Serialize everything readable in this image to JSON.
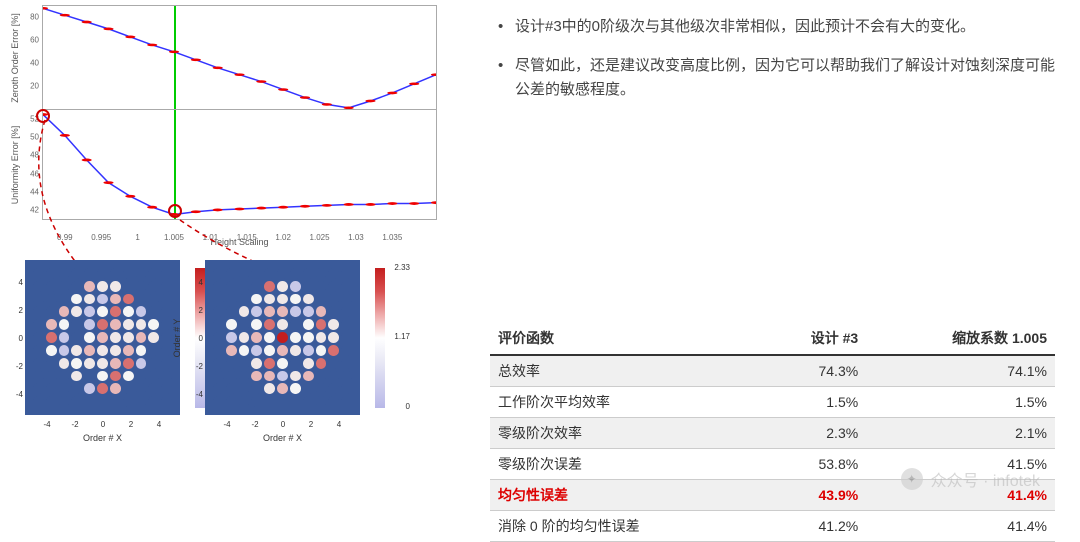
{
  "bullets": [
    "设计#3中的0阶级次与其他级次非常相似，因此预计不会有大的变化。",
    "尽管如此，还是建议改变高度比例，因为它可以帮助我们了解设计对蚀刻深度可能公差的敏感程度。"
  ],
  "chart_data": [
    {
      "type": "line",
      "title": "",
      "ylabel": "Zeroth Order Error [%]",
      "xlabel": "",
      "xlim": [
        0.987,
        1.041
      ],
      "ylim": [
        0,
        90
      ],
      "yticks": [
        20,
        40,
        60,
        80
      ],
      "x": [
        0.987,
        0.99,
        0.993,
        0.996,
        0.999,
        1.002,
        1.005,
        1.008,
        1.011,
        1.014,
        1.017,
        1.02,
        1.023,
        1.026,
        1.029,
        1.032,
        1.035,
        1.038,
        1.041
      ],
      "values": [
        88,
        82,
        76,
        70,
        63,
        56,
        50,
        43,
        36,
        30,
        24,
        17,
        10,
        4,
        1,
        7,
        14,
        22,
        30
      ],
      "vline_x": 1.005
    },
    {
      "type": "line",
      "title": "",
      "ylabel": "Uniformity Error [%]",
      "xlabel": "Height Scaling",
      "xlim": [
        0.987,
        1.041
      ],
      "ylim": [
        41,
        53
      ],
      "yticks": [
        42,
        44,
        46,
        48,
        50,
        52
      ],
      "xticks": [
        0.99,
        0.995,
        1,
        1.005,
        1.01,
        1.015,
        1.02,
        1.025,
        1.03,
        1.035
      ],
      "x": [
        0.987,
        0.99,
        0.993,
        0.996,
        0.999,
        1.002,
        1.005,
        1.008,
        1.011,
        1.014,
        1.017,
        1.02,
        1.023,
        1.026,
        1.029,
        1.032,
        1.035,
        1.038,
        1.041
      ],
      "values": [
        52.5,
        50.2,
        47.5,
        45.0,
        43.5,
        42.3,
        41.5,
        41.8,
        42.0,
        42.1,
        42.2,
        42.3,
        42.4,
        42.5,
        42.6,
        42.6,
        42.7,
        42.7,
        42.8
      ],
      "vline_x": 1.005,
      "highlight_points": [
        {
          "x": 0.987,
          "y": 52.5
        },
        {
          "x": 1.005,
          "y": 41.5
        }
      ]
    }
  ],
  "heatmaps": {
    "ylabel": "Order # Y",
    "xlabel": "Order # X",
    "axis_ticks": [
      -4,
      -2,
      0,
      2,
      4
    ],
    "colorbar": {
      "min": 0,
      "mid": 1.17,
      "max": 2.33
    }
  },
  "table": {
    "headers": [
      "评价函数",
      "设计 #3",
      "缩放系数 1.005"
    ],
    "rows": [
      {
        "label": "总效率",
        "a": "74.3%",
        "b": "74.1%",
        "shade": true
      },
      {
        "label": "工作阶次平均效率",
        "a": "1.5%",
        "b": "1.5%",
        "shade": false
      },
      {
        "label": "零级阶次效率",
        "a": "2.3%",
        "b": "2.1%",
        "shade": true
      },
      {
        "label": "零级阶次误差",
        "a": "53.8%",
        "b": "41.5%",
        "shade": false
      },
      {
        "label": "均匀性误差",
        "a": "43.9%",
        "b": "41.4%",
        "shade": true,
        "red": true
      },
      {
        "label": "消除 0 阶的均匀性误差",
        "a": "41.2%",
        "b": "41.4%",
        "shade": false
      }
    ]
  },
  "watermark": "众众号 · infotek"
}
